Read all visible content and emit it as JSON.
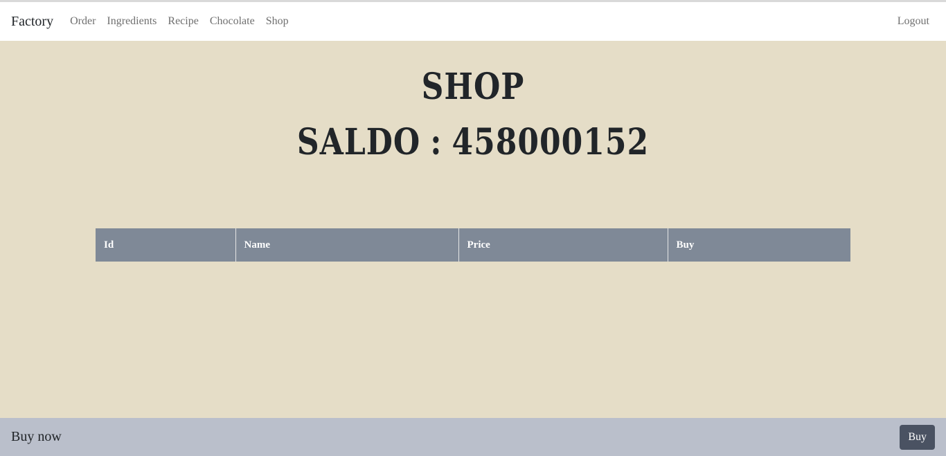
{
  "navbar": {
    "brand": "Factory",
    "links": [
      {
        "label": "Order"
      },
      {
        "label": "Ingredients"
      },
      {
        "label": "Recipe"
      },
      {
        "label": "Chocolate"
      },
      {
        "label": "Shop"
      }
    ],
    "logout_label": "Logout"
  },
  "main": {
    "title": "SHOP",
    "saldo_label": "SALDO",
    "saldo_separator": ":",
    "saldo_value": "458000152"
  },
  "table": {
    "columns": [
      "Id",
      "Name",
      "Price",
      "Buy"
    ],
    "rows": []
  },
  "footer": {
    "text": "Buy now",
    "buy_label": "Buy"
  },
  "colors": {
    "page_background": "#e5ddc7",
    "table_header": "#7f8997",
    "footer_background": "#babfcb",
    "buy_button": "#4a5262"
  }
}
